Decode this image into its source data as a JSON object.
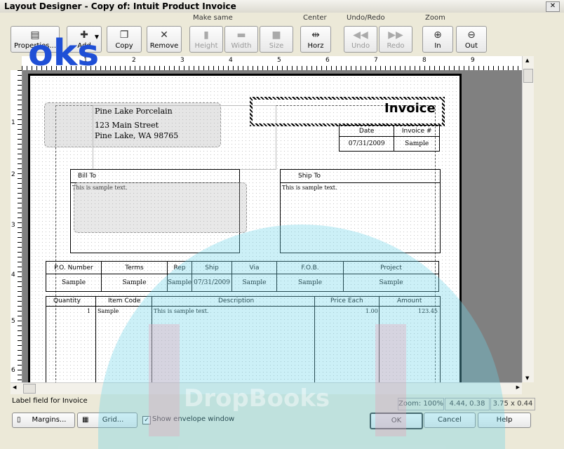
{
  "window": {
    "title": "Layout Designer - Copy of: Intuit Product Invoice",
    "close_label": "✕"
  },
  "toolbar": {
    "properties": "Properties...",
    "add": "Add",
    "copy": "Copy",
    "remove": "Remove",
    "make_same_label": "Make same",
    "height": "Height",
    "width": "Width",
    "size": "Size",
    "center_label": "Center",
    "horz": "Horz",
    "undo_redo_label": "Undo/Redo",
    "undo": "Undo",
    "redo": "Redo",
    "zoom_label": "Zoom",
    "zoom_in": "In",
    "zoom_out": "Out"
  },
  "ruler": {
    "h_marks": [
      "1",
      "2",
      "3",
      "4",
      "5",
      "6",
      "7",
      "8",
      "9"
    ],
    "v_marks": [
      "1",
      "2",
      "3",
      "4",
      "5",
      "6"
    ]
  },
  "invoice": {
    "company_name": "Pine Lake Porcelain",
    "address_line1": "123 Main Street",
    "address_line2": "Pine Lake, WA 98765",
    "title": "Invoice",
    "date_label": "Date",
    "invoice_no_label": "Invoice #",
    "date_value": "07/31/2009",
    "invoice_no_value": "Sample",
    "bill_to_label": "Bill To",
    "bill_to_text": "This is sample text.",
    "ship_to_label": "Ship To",
    "ship_to_text": "This is sample text.",
    "info_headers": [
      "P.O. Number",
      "Terms",
      "Rep",
      "Ship",
      "Via",
      "F.O.B.",
      "Project"
    ],
    "info_values": [
      "Sample",
      "Sample",
      "Sample",
      "07/31/2009",
      "Sample",
      "Sample",
      "Sample"
    ],
    "item_headers": [
      "Quantity",
      "Item Code",
      "Description",
      "Price Each",
      "Amount"
    ],
    "item_row": [
      "1",
      "Sample",
      "This is sample text.",
      "1.00",
      "123.45"
    ]
  },
  "status": {
    "label": "Label field for Invoice",
    "zoom": "Zoom: 100%",
    "position": "4.44, 0.38",
    "size": "3.75 x 0.44"
  },
  "footer": {
    "margins": "Margins...",
    "grid": "Grid...",
    "show_envelope": "Show envelope window",
    "show_envelope_checked": true,
    "ok": "OK",
    "cancel": "Cancel",
    "help": "Help"
  },
  "watermark": {
    "text_top": "oks",
    "text_bottom": "DropBooks"
  },
  "colors": {
    "accent": "#3366cc",
    "watermark_cyan": "#6ed3e8",
    "watermark_pink": "#e8a0b4"
  }
}
